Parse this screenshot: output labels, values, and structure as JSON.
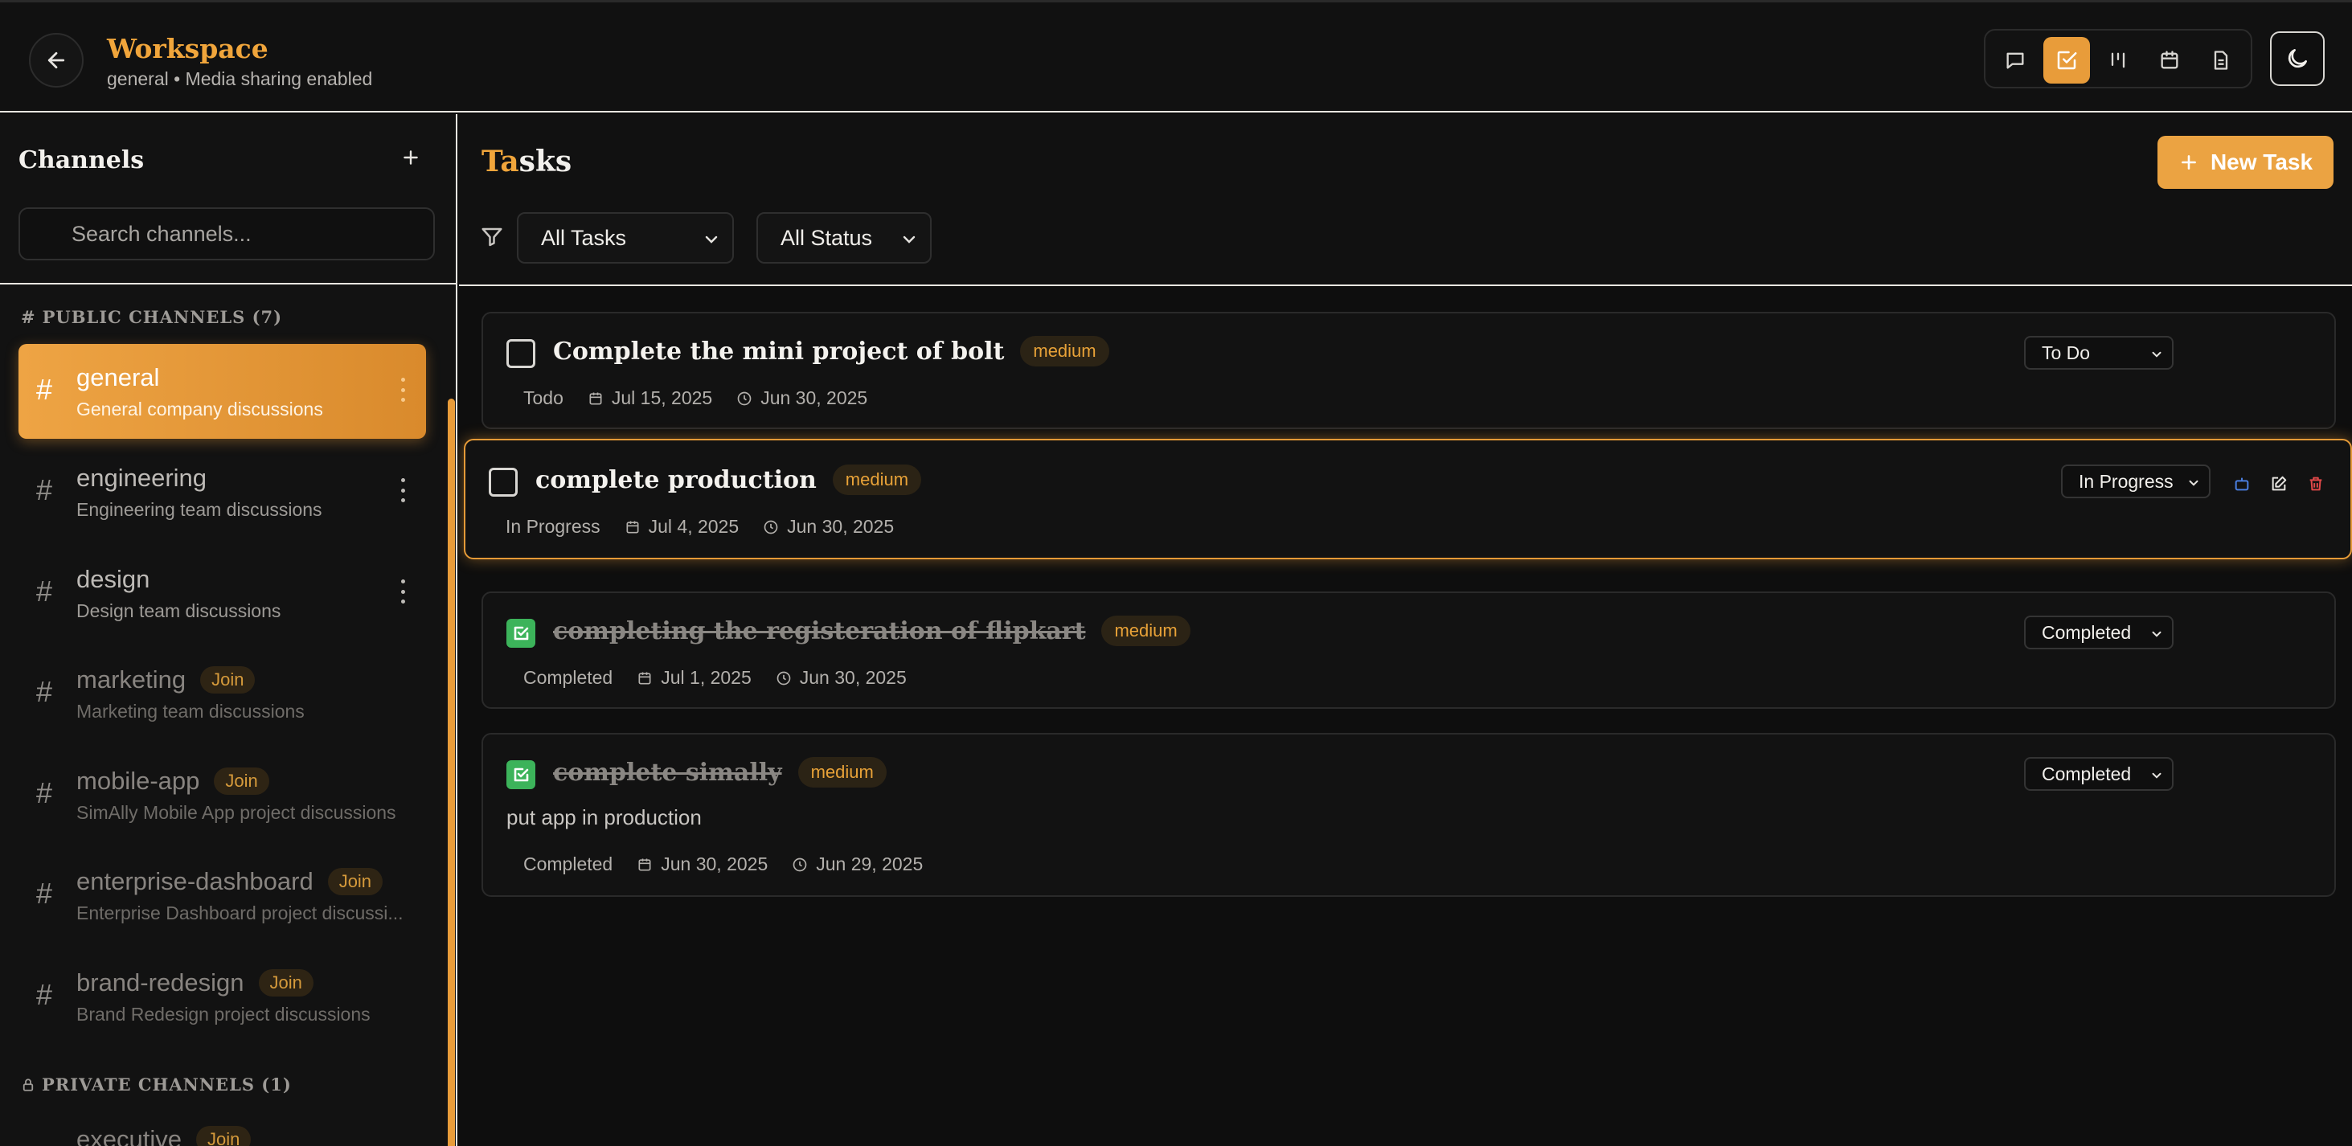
{
  "header": {
    "title": "Workspace",
    "subtitle": "general • Media sharing enabled",
    "views": [
      "chat-icon",
      "tasks-icon",
      "kanban-icon",
      "calendar-icon",
      "document-icon"
    ],
    "active_view": "tasks-icon",
    "theme_icon": "moon-icon"
  },
  "sidebar": {
    "title": "Channels",
    "search_placeholder": "Search channels...",
    "public_label": "PUBLIC CHANNELS (7)",
    "private_label": "PRIVATE CHANNELS (1)",
    "join_label": "Join",
    "channels": [
      {
        "name": "general",
        "desc": "General company discussions",
        "joined": true,
        "active": true
      },
      {
        "name": "engineering",
        "desc": "Engineering team discussions",
        "joined": true,
        "active": false
      },
      {
        "name": "design",
        "desc": "Design team discussions",
        "joined": true,
        "active": false
      },
      {
        "name": "marketing",
        "desc": "Marketing team discussions",
        "joined": false,
        "active": false
      },
      {
        "name": "mobile-app",
        "desc": "SimAlly Mobile App project discussions",
        "joined": false,
        "active": false
      },
      {
        "name": "enterprise-dashboard",
        "desc": "Enterprise Dashboard project discussi...",
        "joined": false,
        "active": false
      },
      {
        "name": "brand-redesign",
        "desc": "Brand Redesign project discussions",
        "joined": false,
        "active": false
      }
    ],
    "private_channels": [
      {
        "name": "executive",
        "joined": false
      }
    ]
  },
  "main": {
    "title_accent": "Ta",
    "title_rest": "sks",
    "new_task_label": "New Task",
    "filter_tasks": "All Tasks",
    "filter_status": "All Status",
    "tasks": [
      {
        "title": "Complete the mini project of bolt",
        "priority": "medium",
        "status": "Todo",
        "created": "Jul 15, 2025",
        "due": "Jun 30, 2025",
        "select": "To Do",
        "done": false,
        "description": ""
      },
      {
        "title": "complete production",
        "priority": "medium",
        "status": "In Progress",
        "created": "Jul 4, 2025",
        "due": "Jun 30, 2025",
        "select": "In Progress",
        "done": false,
        "description": ""
      },
      {
        "title": "completing the registeration of flipkart",
        "priority": "medium",
        "status": "Completed",
        "created": "Jul 1, 2025",
        "due": "Jun 30, 2025",
        "select": "Completed",
        "done": true,
        "description": ""
      },
      {
        "title": "complete simally",
        "priority": "medium",
        "status": "Completed",
        "created": "Jun 30, 2025",
        "due": "Jun 29, 2025",
        "select": "Completed",
        "done": true,
        "description": "put app in production"
      }
    ]
  },
  "colors": {
    "accent": "#eba342",
    "done": "#3cb35a",
    "delete": "#e04848",
    "ai": "#4a7ee0"
  }
}
